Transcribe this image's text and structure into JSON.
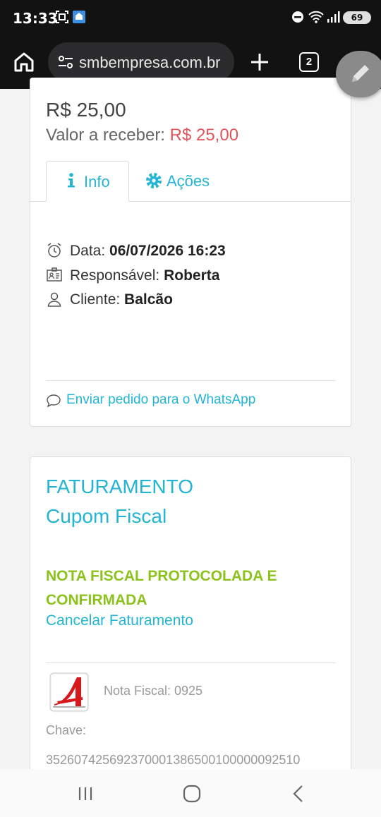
{
  "status_bar": {
    "time": "13:33",
    "battery": "69",
    "icons": [
      "screenshot-icon",
      "app-notification-icon",
      "do-not-disturb-icon",
      "wifi-icon",
      "signal-icon",
      "battery-icon"
    ]
  },
  "browser": {
    "url": "smbempresa.com.br",
    "tab_count": "2",
    "icons": [
      "home-icon",
      "site-settings-icon",
      "plus-icon",
      "menu-icon",
      "edit-icon"
    ]
  },
  "order_card": {
    "price": "R$ 25,00",
    "receive_label": "Valor a receber: ",
    "receive_value": "R$ 25,00",
    "tabs": [
      {
        "label": "Info",
        "icon": "info-icon",
        "active": true
      },
      {
        "label": "Ações",
        "icon": "gear-icon",
        "active": false
      }
    ],
    "details": [
      {
        "icon": "alarm-clock-icon",
        "label": "Data: ",
        "value": "06/07/2026 16:23"
      },
      {
        "icon": "id-card-icon",
        "label": "Responsável: ",
        "value": "Roberta"
      },
      {
        "icon": "user-icon",
        "label": "Cliente: ",
        "value": "Balcão"
      }
    ],
    "whatsapp_link": "Enviar pedido para o WhatsApp"
  },
  "billing_card": {
    "title": "FATURAMENTO",
    "subtitle": "Cupom Fiscal",
    "status": "NOTA FISCAL PROTOCOLADA E CONFIRMADA",
    "cancel_link": "Cancelar Faturamento",
    "nota_fiscal": "Nota Fiscal: 0925",
    "chave_label": "Chave:",
    "chave_value": "352607425692370001386500100000092510"
  },
  "colors": {
    "accent": "#23b5d3",
    "price_red": "#e2545b",
    "status_green": "#8cc21c",
    "dark_bar": "#121212"
  }
}
